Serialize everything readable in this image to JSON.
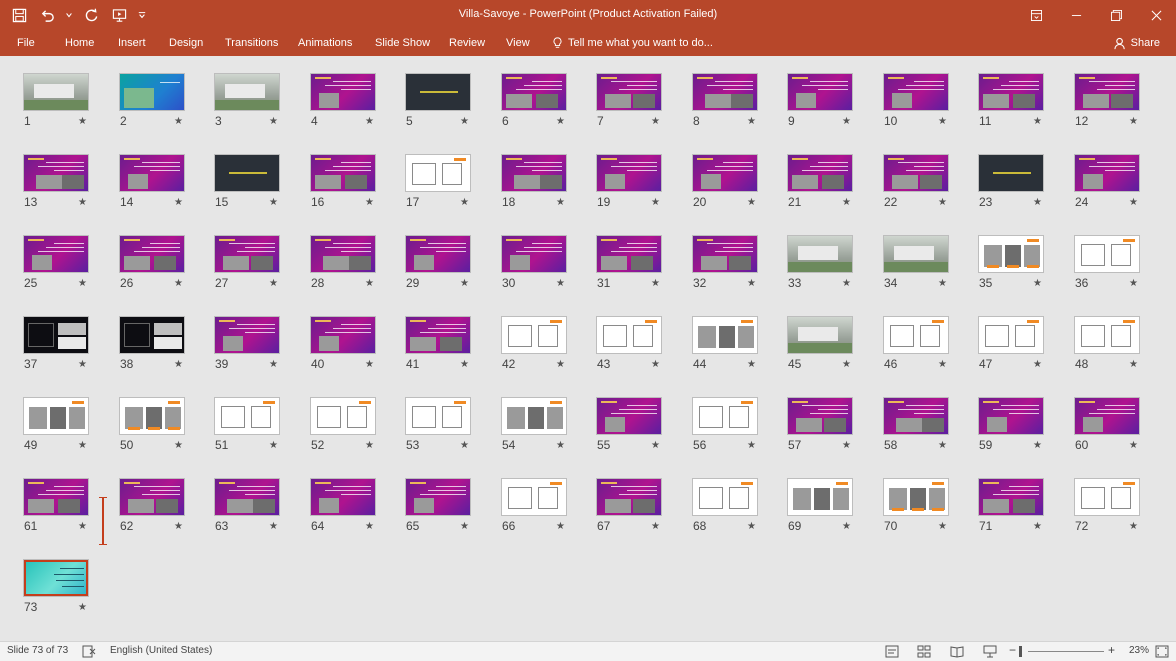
{
  "window": {
    "title": "Villa-Savoye - PowerPoint (Product Activation Failed)"
  },
  "ribbon": {
    "tabs": [
      "File",
      "Home",
      "Insert",
      "Design",
      "Transitions",
      "Animations",
      "Slide Show",
      "Review",
      "View"
    ],
    "tell_me": "Tell me what you want to do...",
    "share": "Share"
  },
  "status": {
    "slide_info": "Slide 73 of 73",
    "language": "English (United States)",
    "zoom": "23%"
  },
  "colors": {
    "accent": "#b7472a",
    "purple_a": "#6b1d8e",
    "purple_b": "#b0138f",
    "dark": "#2a3038",
    "orange": "#f08a24"
  },
  "slides": [
    {
      "n": "1",
      "t": "photo"
    },
    {
      "n": "2",
      "t": "teal"
    },
    {
      "n": "3",
      "t": "photo"
    },
    {
      "n": "4",
      "t": "purple"
    },
    {
      "n": "5",
      "t": "dark"
    },
    {
      "n": "6",
      "t": "purple"
    },
    {
      "n": "7",
      "t": "purple"
    },
    {
      "n": "8",
      "t": "purple"
    },
    {
      "n": "9",
      "t": "purple"
    },
    {
      "n": "10",
      "t": "purple"
    },
    {
      "n": "11",
      "t": "purple"
    },
    {
      "n": "12",
      "t": "purple"
    },
    {
      "n": "13",
      "t": "purple"
    },
    {
      "n": "14",
      "t": "purple"
    },
    {
      "n": "15",
      "t": "dark"
    },
    {
      "n": "16",
      "t": "purple"
    },
    {
      "n": "17",
      "t": "white"
    },
    {
      "n": "18",
      "t": "purple"
    },
    {
      "n": "19",
      "t": "purple"
    },
    {
      "n": "20",
      "t": "purple"
    },
    {
      "n": "21",
      "t": "purple"
    },
    {
      "n": "22",
      "t": "purple"
    },
    {
      "n": "23",
      "t": "dark"
    },
    {
      "n": "24",
      "t": "purple"
    },
    {
      "n": "25",
      "t": "purple"
    },
    {
      "n": "26",
      "t": "purple"
    },
    {
      "n": "27",
      "t": "purple"
    },
    {
      "n": "28",
      "t": "purple"
    },
    {
      "n": "29",
      "t": "purple"
    },
    {
      "n": "30",
      "t": "purple"
    },
    {
      "n": "31",
      "t": "purple"
    },
    {
      "n": "32",
      "t": "purple"
    },
    {
      "n": "33",
      "t": "photo"
    },
    {
      "n": "34",
      "t": "photo"
    },
    {
      "n": "35",
      "t": "white"
    },
    {
      "n": "36",
      "t": "white"
    },
    {
      "n": "37",
      "t": "black"
    },
    {
      "n": "38",
      "t": "black"
    },
    {
      "n": "39",
      "t": "purple"
    },
    {
      "n": "40",
      "t": "purple"
    },
    {
      "n": "41",
      "t": "purple"
    },
    {
      "n": "42",
      "t": "white"
    },
    {
      "n": "43",
      "t": "white"
    },
    {
      "n": "44",
      "t": "white"
    },
    {
      "n": "45",
      "t": "photo"
    },
    {
      "n": "46",
      "t": "white"
    },
    {
      "n": "47",
      "t": "white"
    },
    {
      "n": "48",
      "t": "white"
    },
    {
      "n": "49",
      "t": "white"
    },
    {
      "n": "50",
      "t": "white"
    },
    {
      "n": "51",
      "t": "white"
    },
    {
      "n": "52",
      "t": "white"
    },
    {
      "n": "53",
      "t": "white"
    },
    {
      "n": "54",
      "t": "white"
    },
    {
      "n": "55",
      "t": "purple"
    },
    {
      "n": "56",
      "t": "white"
    },
    {
      "n": "57",
      "t": "purple"
    },
    {
      "n": "58",
      "t": "purple"
    },
    {
      "n": "59",
      "t": "purple"
    },
    {
      "n": "60",
      "t": "purple"
    },
    {
      "n": "61",
      "t": "purple"
    },
    {
      "n": "62",
      "t": "purple"
    },
    {
      "n": "63",
      "t": "purple"
    },
    {
      "n": "64",
      "t": "purple"
    },
    {
      "n": "65",
      "t": "purple"
    },
    {
      "n": "66",
      "t": "white"
    },
    {
      "n": "67",
      "t": "purple"
    },
    {
      "n": "68",
      "t": "white"
    },
    {
      "n": "69",
      "t": "white"
    },
    {
      "n": "70",
      "t": "white"
    },
    {
      "n": "71",
      "t": "purple"
    },
    {
      "n": "72",
      "t": "white"
    },
    {
      "n": "73",
      "t": "cyan"
    }
  ]
}
